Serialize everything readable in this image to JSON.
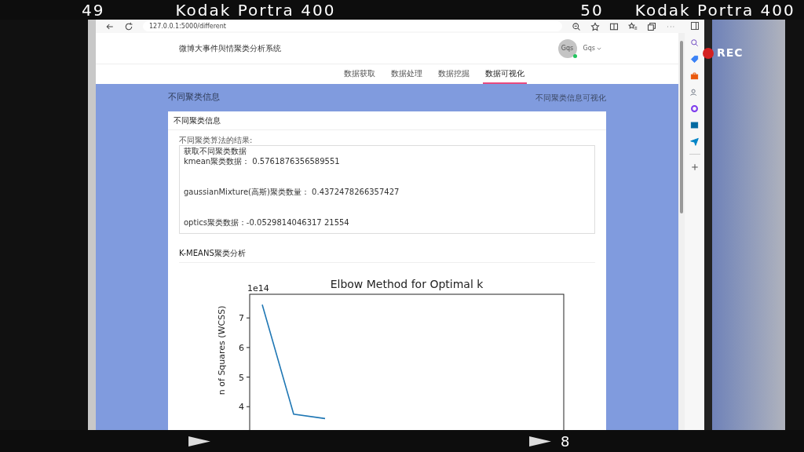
{
  "film": {
    "top": [
      {
        "text": "49"
      },
      {
        "text": "Kodak Portra 400"
      },
      {
        "text": "50"
      },
      {
        "text": "Kodak Portra 400"
      }
    ],
    "rec": "REC",
    "frame_number": "8"
  },
  "browser": {
    "url": "127.0.0.1:5000/different"
  },
  "site": {
    "title": "微博大事件與情聚类分析系统",
    "user": {
      "avatar": "Gqs",
      "name": "Gqs",
      "online": true
    }
  },
  "nav": [
    {
      "label": "数据获取",
      "selected": false
    },
    {
      "label": "数据处理",
      "selected": false
    },
    {
      "label": "数据挖掘",
      "selected": false
    },
    {
      "label": "数据可视化",
      "selected": true
    }
  ],
  "page": {
    "title": "不同聚类信息",
    "link": "不同聚类信息可视化"
  },
  "card": {
    "title": "不同聚类信息",
    "label": "不同聚类算法的结果:",
    "results": [
      "获取不同聚类数据",
      "kmean聚类数据： 0.5761876356589551",
      "gaussianMixture(高斯)聚类数量： 0.4372478266357427",
      "optics聚类数据：-0.0529814046317 21554"
    ],
    "section": "K-MEANS聚类分析",
    "chart_data": {
      "type": "line",
      "title": "Elbow Method for Optimal k",
      "ylabel": "n of Squares (WCSS)",
      "ylim": [
        3,
        7.8
      ],
      "yticks": [
        4,
        5,
        6,
        7
      ],
      "annotations": [
        "1e14"
      ],
      "series": [
        {
          "color": "#1f77b4",
          "values": [
            7.45,
            3.75,
            3.6
          ]
        }
      ]
    }
  }
}
